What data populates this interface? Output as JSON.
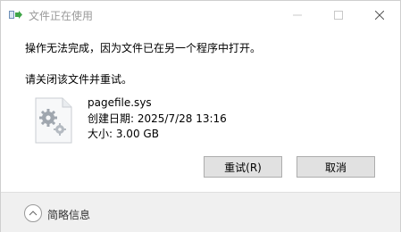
{
  "window": {
    "title": "文件正在使用"
  },
  "dialog": {
    "message": "操作无法完成，因为文件已在另一个程序中打开。",
    "sub_message": "请关闭该文件并重试。",
    "file": {
      "icon": "system-file-gears-icon",
      "name": "pagefile.sys",
      "created": "创建日期: 2025/7/28 13:16",
      "size": "大小: 3.00 GB"
    }
  },
  "buttons": {
    "retry_label": "重试(R)",
    "cancel_label": "取消"
  },
  "footer": {
    "details_label": "简略信息",
    "details_icon": "chevron-up-icon"
  },
  "colors": {
    "footer_bg": "#f0f0f0",
    "button_bg": "#e1e1e1",
    "title_text": "#9a9a9a"
  }
}
